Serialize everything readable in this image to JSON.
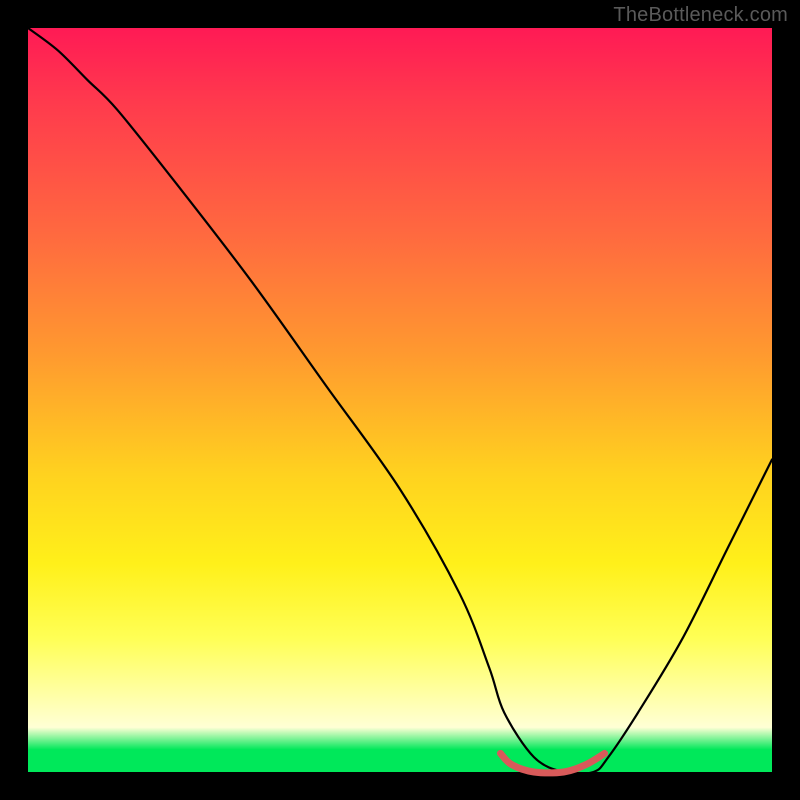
{
  "watermark": "TheBottleneck.com",
  "colors": {
    "frame": "#000000",
    "grad_top": "#ff1a55",
    "grad_bottom_green": "#00e85a",
    "curve_stroke": "#000000",
    "marker_stroke": "#d85a5a"
  },
  "chart_data": {
    "type": "line",
    "title": "",
    "xlabel": "",
    "ylabel": "",
    "xlim": [
      0,
      100
    ],
    "ylim": [
      0,
      100
    ],
    "series": [
      {
        "name": "bottleneck-curve",
        "x": [
          0,
          4,
          8,
          12,
          20,
          30,
          40,
          50,
          58,
          62,
          64,
          68,
          72,
          76,
          78,
          82,
          88,
          94,
          100
        ],
        "values": [
          100,
          97,
          93,
          89,
          79,
          66,
          52,
          38,
          24,
          14,
          8,
          2,
          0,
          0,
          2,
          8,
          18,
          30,
          42
        ]
      }
    ],
    "annotations": [
      {
        "name": "flat-minimum-marker",
        "x": [
          63.5,
          65,
          68,
          72,
          75,
          77.5
        ],
        "values": [
          2.5,
          1,
          0,
          0,
          1,
          2.5
        ]
      }
    ]
  }
}
